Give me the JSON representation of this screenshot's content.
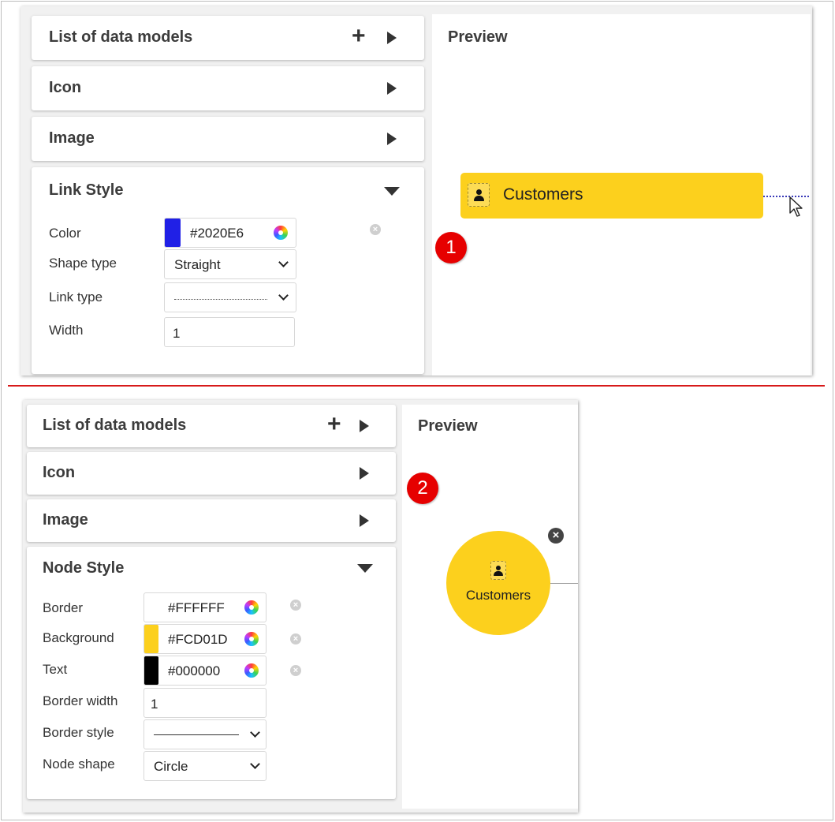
{
  "colors": {
    "accent_yellow": "#FCD01D",
    "badge_red": "#E60000",
    "separator_red": "#D71A1A",
    "link_blue": "#2020E6"
  },
  "screenshot1": {
    "panels": {
      "list_title": "List of data models",
      "icon_title": "Icon",
      "image_title": "Image",
      "style_title": "Link Style"
    },
    "link_style": {
      "color_label": "Color",
      "color_value": "#2020E6",
      "shape_label": "Shape type",
      "shape_value": "Straight",
      "link_type_label": "Link type",
      "width_label": "Width",
      "width_value": "1"
    },
    "preview": {
      "title": "Preview",
      "node_label": "Customers"
    },
    "badge": "1"
  },
  "screenshot2": {
    "panels": {
      "list_title": "List of data models",
      "icon_title": "Icon",
      "image_title": "Image",
      "style_title": "Node Style"
    },
    "node_style": {
      "border_label": "Border",
      "border_value": "#FFFFFF",
      "background_label": "Background",
      "background_value": "#FCD01D",
      "text_label": "Text",
      "text_value": "#000000",
      "border_width_label": "Border width",
      "border_width_value": "1",
      "border_style_label": "Border style",
      "node_shape_label": "Node shape",
      "node_shape_value": "Circle"
    },
    "preview": {
      "title": "Preview",
      "node_label": "Customers"
    },
    "badge": "2"
  },
  "icons": [
    "plus-icon",
    "caret-right-icon",
    "caret-down-icon",
    "color-wheel-icon",
    "clear-icon",
    "chevron-down-icon",
    "person-icon",
    "mouse-cursor-icon",
    "close-icon"
  ]
}
